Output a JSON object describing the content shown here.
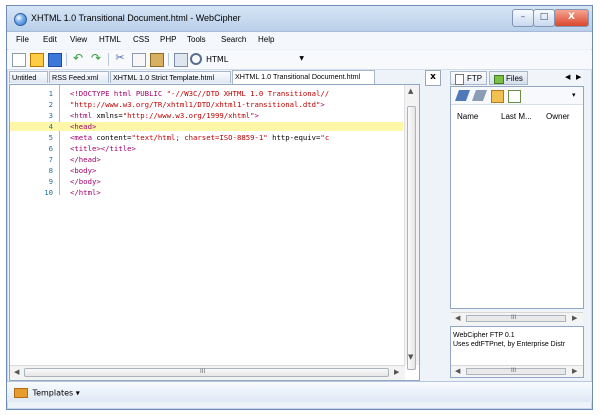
{
  "window": {
    "title": "XHTML 1.0 Transitional Document.html - WebCipher",
    "controls": {
      "minimize": "–",
      "maximize": "□",
      "close": "X"
    }
  },
  "menu": [
    "File",
    "Edit",
    "View",
    "HTML",
    "CSS",
    "PHP",
    "Tools",
    "Search",
    "Help"
  ],
  "toolbar": {
    "doctype": "HTML",
    "icons": [
      "new-file",
      "open-folder",
      "save",
      "undo",
      "redo",
      "cut",
      "copy",
      "paste",
      "print",
      "find"
    ]
  },
  "tabs": [
    "Untitled",
    "RSS Feed.xml",
    "XHTML 1.0 Strict Template.html",
    "XHTML 1.0 Transitional Document.html"
  ],
  "close_document": "x",
  "editor": {
    "lines": [
      {
        "no": "1",
        "parts": [
          {
            "cls": "tag",
            "text": "<!DOCTYPE html PUBLIC "
          },
          {
            "cls": "str",
            "text": "\"-//W3C//DTD XHTML 1.0 Transitional//"
          }
        ]
      },
      {
        "no": "2",
        "parts": [
          {
            "cls": "str",
            "text": "\"http://www.w3.org/TR/xhtml1/DTD/xhtml1-transitional.dtd\""
          },
          {
            "cls": "tag",
            "text": ">"
          }
        ]
      },
      {
        "no": "3",
        "parts": [
          {
            "cls": "tag",
            "text": "<html "
          },
          {
            "cls": "plain",
            "text": "xmlns="
          },
          {
            "cls": "str",
            "text": "\"http://www.w3.org/1999/xhtml\""
          },
          {
            "cls": "tag",
            "text": ">"
          }
        ]
      },
      {
        "no": "4",
        "parts": [
          {
            "cls": "tag",
            "text": "<head>"
          }
        ],
        "highlight": true
      },
      {
        "no": "5",
        "parts": [
          {
            "cls": "tag",
            "text": "<meta "
          },
          {
            "cls": "plain",
            "text": "content="
          },
          {
            "cls": "str",
            "text": "\"text/html; charset=ISO-8859-1\""
          },
          {
            "cls": "plain",
            "text": " http-equiv="
          },
          {
            "cls": "str",
            "text": "\"c"
          }
        ]
      },
      {
        "no": "6",
        "parts": [
          {
            "cls": "tag",
            "text": "<title></title>"
          }
        ]
      },
      {
        "no": "7",
        "parts": [
          {
            "cls": "tag",
            "text": "</head>"
          }
        ]
      },
      {
        "no": "8",
        "parts": [
          {
            "cls": "tag",
            "text": "<body>"
          }
        ]
      },
      {
        "no": "9",
        "parts": [
          {
            "cls": "tag",
            "text": "</body>"
          }
        ]
      },
      {
        "no": "10",
        "parts": [
          {
            "cls": "tag",
            "text": "</html>"
          }
        ]
      }
    ]
  },
  "right_panel": {
    "tabs": [
      "FTP",
      "Files"
    ],
    "columns": [
      "Name",
      "Last M...",
      "Owner"
    ],
    "log": [
      "WebCipher FTP 0.1",
      "Uses edtFTPnet, by Enterprise Distr"
    ],
    "scroll_label": "III"
  },
  "scroll": {
    "editor_horizontal_label": "III"
  },
  "status": {
    "templates": "Templates ▾"
  }
}
